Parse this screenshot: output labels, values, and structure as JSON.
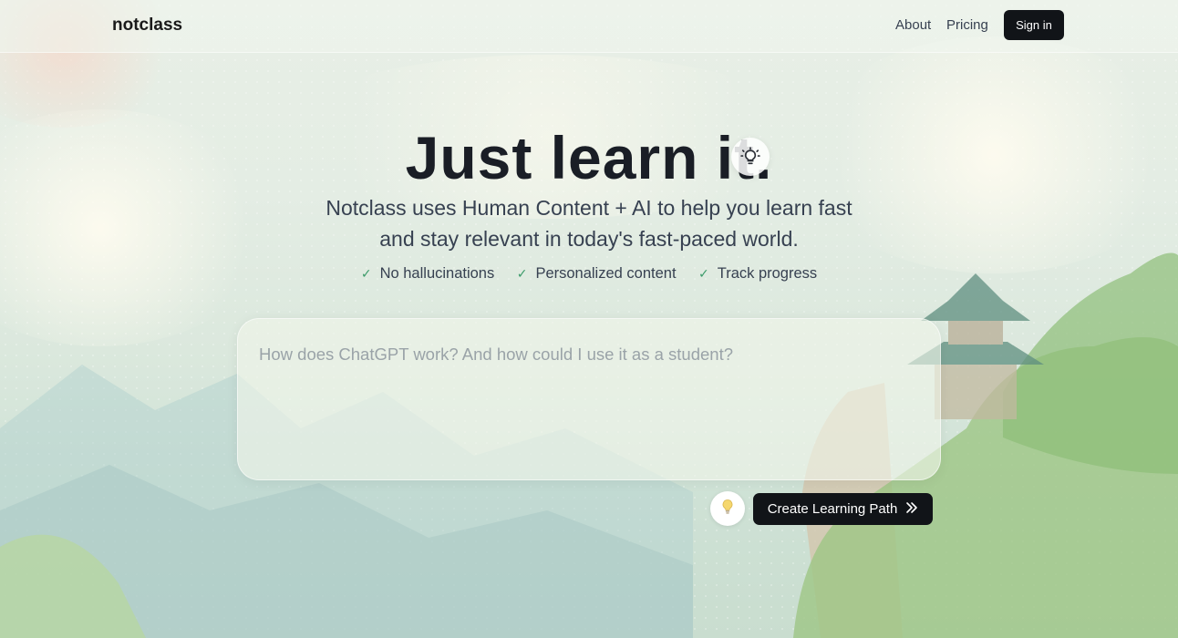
{
  "header": {
    "logo": "notclass",
    "nav": {
      "about": "About",
      "pricing": "Pricing"
    },
    "sign_in": "Sign in"
  },
  "hero": {
    "title": "Just learn it.",
    "subtitle": "Notclass uses Human Content + AI to help you learn fast and stay relevant in today's fast-paced world.",
    "features": [
      "No hallucinations",
      "Personalized content",
      "Track progress"
    ]
  },
  "prompt": {
    "placeholder": "How does ChatGPT work? And how could I use it as a student?",
    "value": ""
  },
  "actions": {
    "create_label": "Create Learning Path"
  },
  "icons": {
    "hero_badge": "lightbulb-icon",
    "suggest": "lightbulb-icon",
    "create": "chevrons-right-icon",
    "feature": "check-icon"
  },
  "colors": {
    "primary_button": "#111418",
    "check": "#3c9b6a"
  }
}
